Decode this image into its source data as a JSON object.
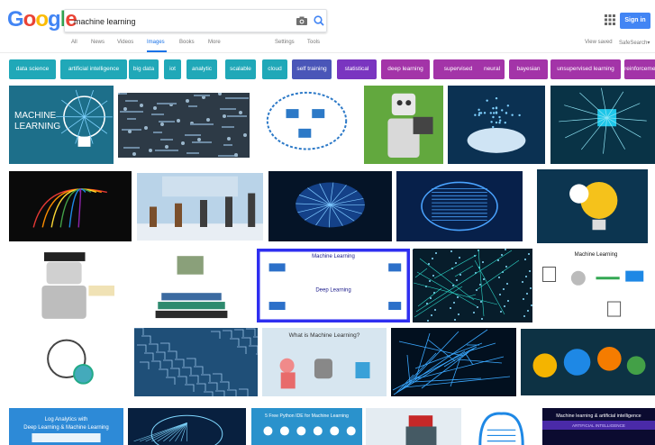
{
  "header": {
    "logo_letters": [
      {
        "ch": "G",
        "color": "#4285f4"
      },
      {
        "ch": "o",
        "color": "#ea4335"
      },
      {
        "ch": "o",
        "color": "#fbbc05"
      },
      {
        "ch": "g",
        "color": "#4285f4"
      },
      {
        "ch": "l",
        "color": "#34a853"
      },
      {
        "ch": "e",
        "color": "#ea4335"
      }
    ],
    "query": "machine learning",
    "signin_label": "Sign in"
  },
  "nav": {
    "tabs": [
      "All",
      "News",
      "Videos",
      "Images",
      "Books",
      "More"
    ],
    "active": "Images",
    "settings": "Settings",
    "tools": "Tools",
    "view_saved": "View saved",
    "safesearch": "SafeSearch▾"
  },
  "chips": [
    {
      "label": "data science",
      "color": "#20a8b8"
    },
    {
      "label": "artificial intelligence",
      "color": "#20a8b8"
    },
    {
      "label": "big data",
      "color": "#20a8b8"
    },
    {
      "label": "iot",
      "color": "#20a8b8"
    },
    {
      "label": "analytic",
      "color": "#20a8b8"
    },
    {
      "label": "scalable",
      "color": "#20a8b8"
    },
    {
      "label": "cloud",
      "color": "#20a8b8"
    },
    {
      "label": "self training",
      "color": "#4a56b8"
    },
    {
      "label": "statistical",
      "color": "#7a35c0"
    },
    {
      "label": "deep learning",
      "color": "#a334a8"
    },
    {
      "label": "supervised",
      "color": "#a334a8"
    },
    {
      "label": "neural",
      "color": "#a334a8"
    },
    {
      "label": "bayesian",
      "color": "#a334a8"
    },
    {
      "label": "unsupervised learning",
      "color": "#a334a8"
    },
    {
      "label": "reinforcement",
      "color": "#a334a8"
    }
  ],
  "image_texts": {
    "t1": "MACHINE\nLEARNING",
    "t16_title": "Machine Learning",
    "t16_sub": "Deep Learning",
    "t18_title": "Machine Learning",
    "t21_title": "What is Machine Learning?",
    "t25_title": "Log Analytics with\nDeep Learning & Machine Learning",
    "t27_title": "5 Free Python IDE for Machine Learning",
    "t30_title": "Machine learning & artificial intelligence",
    "t30_sub": "ARTIFICIAL INTELLIGENCE"
  },
  "tiles": [
    {
      "name": "ml-lightbulb-image",
      "bg": "#1d6f8a",
      "icon": "lightbulb"
    },
    {
      "name": "circuit-board-image",
      "bg": "#2d3a46",
      "icon": "circuit"
    },
    {
      "name": "brain-diagram-image",
      "bg": "#ffffff",
      "icon": "brain-blue"
    },
    {
      "name": "robot-reading-image",
      "bg": "#62a83e",
      "icon": "robot"
    },
    {
      "name": "digital-hand-image",
      "bg": "#0b3152",
      "icon": "hand"
    },
    {
      "name": "network-diagram-image",
      "bg": "#093346",
      "icon": "network"
    },
    {
      "name": "colorful-brain-image",
      "bg": "#0a0a0a",
      "icon": "brain-color"
    },
    {
      "name": "evolution-infographic-image",
      "bg": "#b9d3e8",
      "icon": "evolution"
    },
    {
      "name": "glowing-brain-image",
      "bg": "#051427",
      "icon": "brain-glow"
    },
    {
      "name": "circuit-brain-image",
      "bg": "#07204a",
      "icon": "brain-circuit"
    },
    {
      "name": "gear-bulb-image",
      "bg": "#0c3550",
      "icon": "gearbulb"
    },
    {
      "name": "graduate-robot-image",
      "bg": "#ffffff",
      "icon": "gradrobot"
    },
    {
      "name": "robot-books-image",
      "bg": "#ffffff",
      "icon": "books"
    },
    {
      "name": "ml-vs-dl-diagram-image",
      "bg": "#ffffff",
      "icon": "mldl"
    },
    {
      "name": "data-network-image",
      "bg": "#071d2b",
      "icon": "datanet"
    },
    {
      "name": "ml-flow-diagram-image",
      "bg": "#ffffff",
      "icon": "flow"
    },
    {
      "name": "brain-gear-icon-image",
      "bg": "#ffffff",
      "icon": "braingear"
    },
    {
      "name": "blue-circuit-pattern-image",
      "bg": "#1f4f78",
      "icon": "pattern"
    },
    {
      "name": "what-is-ml-image",
      "bg": "#d7e6f0",
      "icon": "whatis"
    },
    {
      "name": "blue-network-lines-image",
      "bg": "#02101f",
      "icon": "lines"
    },
    {
      "name": "ml-concept-icons-image",
      "bg": "#0d3244",
      "icon": "concept"
    },
    {
      "name": "log-analytics-image",
      "bg": "#2d8ad7",
      "icon": "log"
    },
    {
      "name": "brain-hologram-image",
      "bg": "#08203f",
      "icon": "holo"
    },
    {
      "name": "python-ide-image",
      "bg": "#2a92cc",
      "icon": "python"
    },
    {
      "name": "robot-toy-image",
      "bg": "#e4ecf2",
      "icon": "toyrobot"
    },
    {
      "name": "blue-brain-outline-image",
      "bg": "#ffffff",
      "icon": "brainoutline"
    },
    {
      "name": "ml-ai-banner-image",
      "bg": "#0b0b30",
      "icon": "banner"
    }
  ]
}
